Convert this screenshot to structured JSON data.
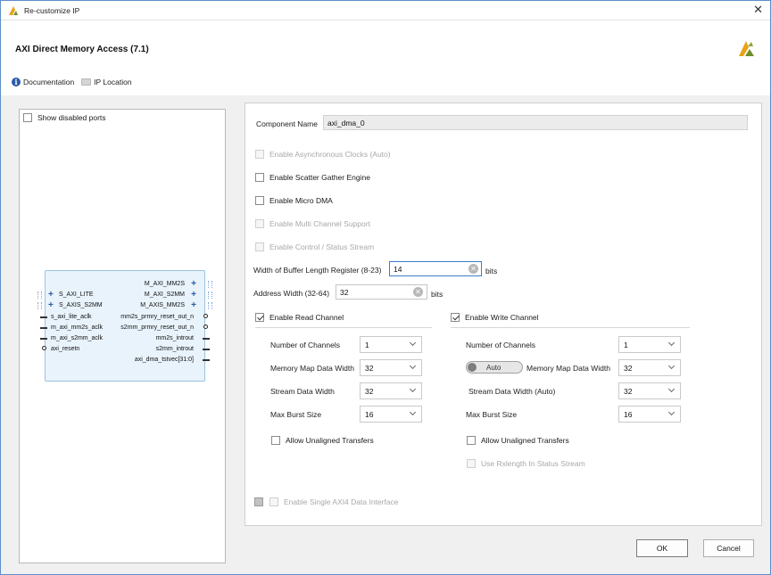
{
  "window": {
    "title": "Re-customize IP",
    "close_glyph": "✕"
  },
  "header": {
    "ip_name": "AXI Direct Memory Access (7.1)",
    "documentation_label": "Documentation",
    "ip_location_label": "IP Location"
  },
  "left_panel": {
    "show_disabled_ports_label": "Show disabled ports",
    "block": {
      "left_ports": [
        {
          "label": "S_AXI_LITE",
          "kind": "bus"
        },
        {
          "label": "S_AXIS_S2MM",
          "kind": "bus"
        },
        {
          "label": "s_axi_lite_aclk",
          "kind": "pin"
        },
        {
          "label": "m_axi_mm2s_aclk",
          "kind": "pin"
        },
        {
          "label": "m_axi_s2mm_aclk",
          "kind": "pin"
        },
        {
          "label": "axi_resetn",
          "kind": "circle"
        }
      ],
      "right_ports": [
        {
          "label": "M_AXI_MM2S",
          "kind": "bus"
        },
        {
          "label": "M_AXI_S2MM",
          "kind": "bus"
        },
        {
          "label": "M_AXIS_MM2S",
          "kind": "bus"
        },
        {
          "label": "mm2s_prmry_reset_out_n",
          "kind": "circle"
        },
        {
          "label": "s2mm_prmry_reset_out_n",
          "kind": "circle"
        },
        {
          "label": "mm2s_introut",
          "kind": "pin"
        },
        {
          "label": "s2mm_introut",
          "kind": "pin"
        },
        {
          "label": "axi_dma_tstvec[31:0]",
          "kind": "pin"
        }
      ]
    }
  },
  "config": {
    "component_name_label": "Component Name",
    "component_name_value": "axi_dma_0",
    "enable_async_clocks": "Enable Asynchronous Clocks (Auto)",
    "enable_scatter_gather": "Enable Scatter Gather Engine",
    "enable_micro_dma": "Enable Micro DMA",
    "enable_multi_channel": "Enable Multi Channel Support",
    "enable_control_status": "Enable Control / Status Stream",
    "buffer_length_label": "Width of Buffer Length Register (8-23)",
    "buffer_length_value": "14",
    "buffer_length_unit": "bits",
    "address_width_label": "Address Width (32-64)",
    "address_width_value": "32",
    "address_width_unit": "bits",
    "read_channel": {
      "enable_label": "Enable Read Channel",
      "num_channels_label": "Number of Channels",
      "num_channels_value": "1",
      "mm_data_width_label": "Memory Map Data Width",
      "mm_data_width_value": "32",
      "stream_width_label": "Stream Data Width",
      "stream_width_value": "32",
      "max_burst_label": "Max Burst Size",
      "max_burst_value": "16",
      "unaligned_label": "Allow Unaligned Transfers"
    },
    "write_channel": {
      "enable_label": "Enable Write Channel",
      "num_channels_label": "Number of Channels",
      "num_channels_value": "1",
      "auto_toggle_label": "Auto",
      "mm_data_width_label": "Memory Map Data Width",
      "mm_data_width_value": "32",
      "stream_width_label": "Stream Data Width (Auto)",
      "stream_width_value": "32",
      "max_burst_label": "Max Burst Size",
      "max_burst_value": "16",
      "unaligned_label": "Allow Unaligned Transfers",
      "rxlength_label": "Use Rxlength In Status Stream"
    },
    "single_axi4_label": "Enable Single AXI4 Data Interface"
  },
  "footer": {
    "ok_label": "OK",
    "cancel_label": "Cancel"
  },
  "colors": {
    "accent": "#3c7fc4",
    "block_fill": "#e8f3fb",
    "xilinx_brand": "#e8a317"
  }
}
